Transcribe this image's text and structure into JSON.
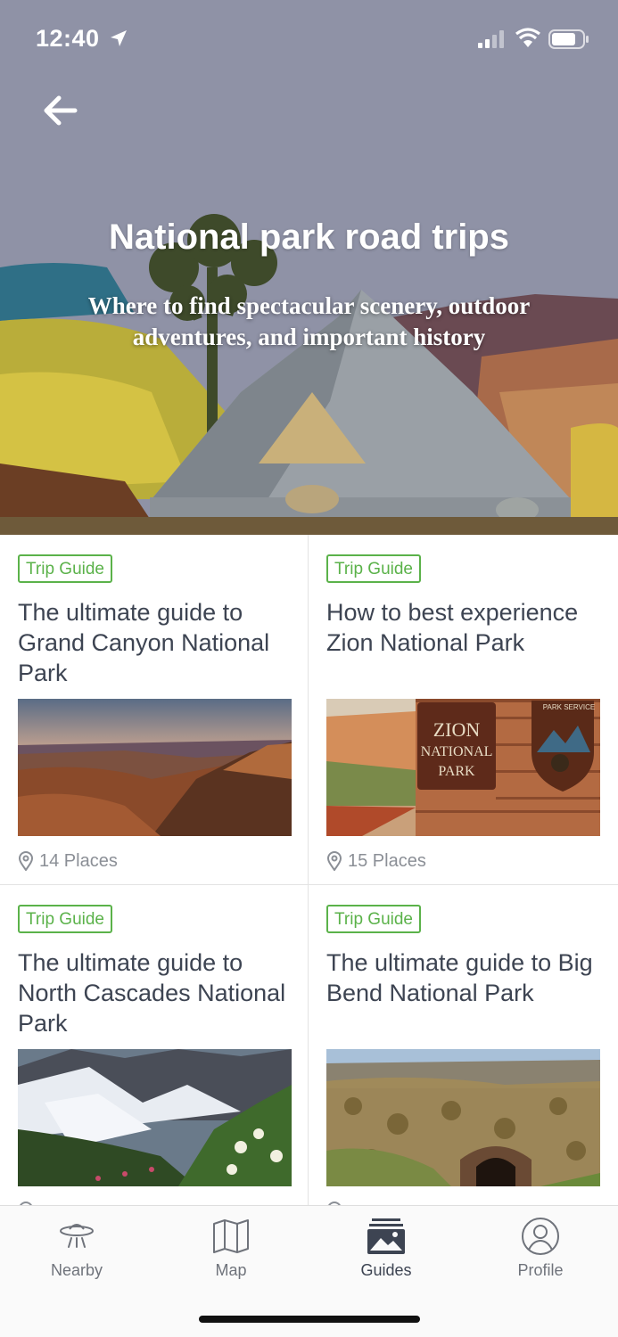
{
  "status_bar": {
    "time": "12:40",
    "icons": [
      "location-arrow-icon",
      "signal-icon",
      "wifi-icon",
      "battery-icon"
    ]
  },
  "header": {
    "back_icon": "arrow-left-icon",
    "title": "National park road trips",
    "subtitle": "Where to find spectacular scenery, outdoor adventures, and important history"
  },
  "guides": [
    {
      "badge": "Trip Guide",
      "title": "The ultimate guide to Grand Canyon National Park",
      "places": "14 Places",
      "image": "grand-canyon-photo"
    },
    {
      "badge": "Trip Guide",
      "title": "How to best experience Zion National Park",
      "places": "15 Places",
      "image": "zion-sign-photo"
    },
    {
      "badge": "Trip Guide",
      "title": "The ultimate guide to North Cascades National Park",
      "places": "",
      "image": "north-cascades-photo"
    },
    {
      "badge": "Trip Guide",
      "title": "The ultimate guide to Big Bend National Park",
      "places": "",
      "image": "big-bend-photo"
    }
  ],
  "zion_sign": {
    "line1": "ZION",
    "line2": "NATIONAL",
    "line3": "PARK",
    "emblem": "PARK SERVICE"
  },
  "tabbar": {
    "tabs": [
      {
        "label": "Nearby",
        "icon": "ufo-icon"
      },
      {
        "label": "Map",
        "icon": "map-icon"
      },
      {
        "label": "Guides",
        "icon": "photos-icon",
        "active": true
      },
      {
        "label": "Profile",
        "icon": "profile-icon"
      }
    ]
  },
  "colors": {
    "accent_green": "#5bb24a",
    "hero_bg": "#8f92a6",
    "text": "#3d4452",
    "muted": "#8b8f96"
  }
}
